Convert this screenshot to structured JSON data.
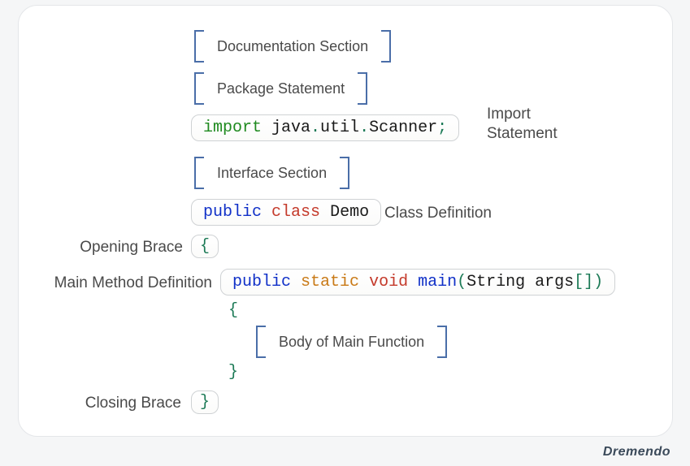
{
  "brand": "Dremendo",
  "placeholders": {
    "documentation": "Documentation Section",
    "package": "Package Statement",
    "interface": "Interface Section",
    "body": "Body of Main Function"
  },
  "labels": {
    "import_stmt": "Import\nStatement",
    "class_def": "Class Definition",
    "opening_brace": "Opening Brace",
    "main_method": "Main Method Definition",
    "closing_brace": "Closing Brace"
  },
  "code": {
    "import_kw": "import",
    "import_pkg_1": " java",
    "import_dot_1": ".",
    "import_pkg_2": "util",
    "import_dot_2": ".",
    "import_cls": "Scanner",
    "import_semi": ";",
    "public": "public",
    "class": "class",
    "demo": "Demo",
    "open_brace": "{",
    "static": "static",
    "void": "void",
    "main": "main",
    "paren_open": "(",
    "string": "String",
    "args": " args",
    "brackets": "[]",
    "paren_close": ")",
    "inner_open": "{",
    "inner_close": "}",
    "close_brace": "}"
  }
}
